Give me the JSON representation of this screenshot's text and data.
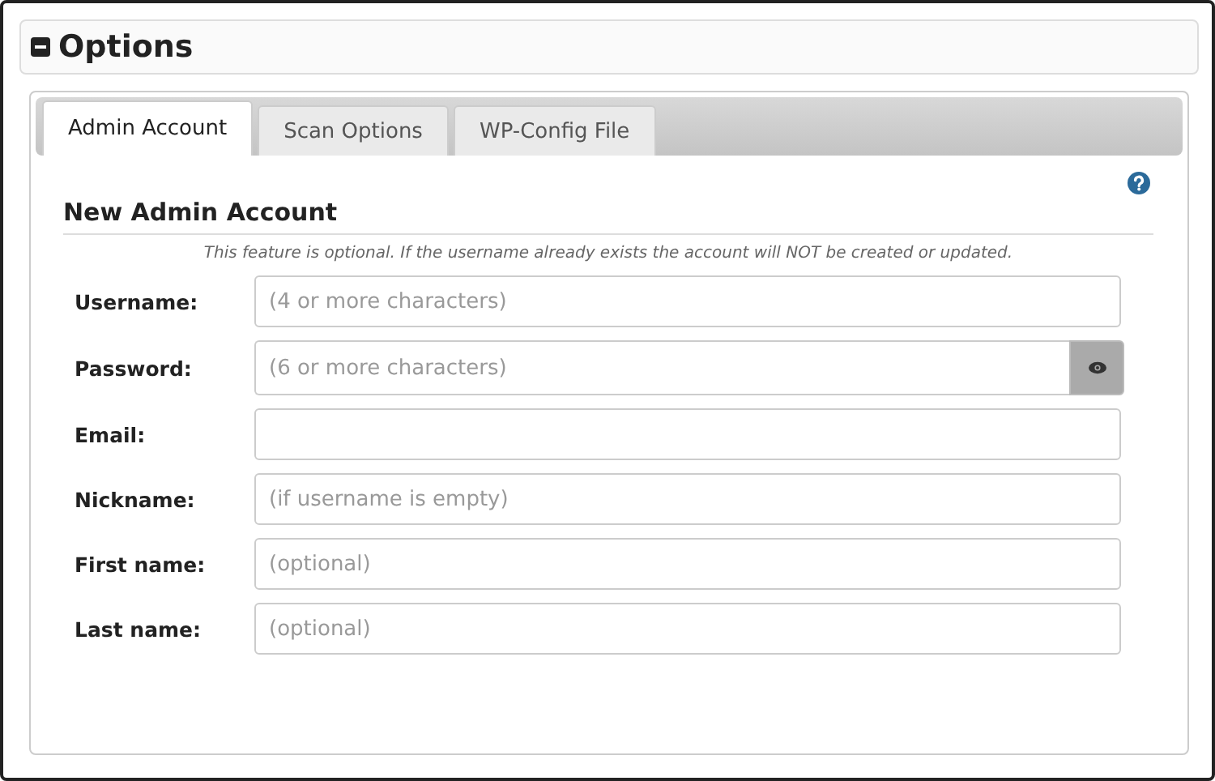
{
  "panel": {
    "title": "Options",
    "expanded": true
  },
  "tabs": [
    {
      "label": "Admin Account",
      "selected": true
    },
    {
      "label": "Scan Options",
      "selected": false
    },
    {
      "label": "WP-Config File",
      "selected": false
    }
  ],
  "section": {
    "title": "New Admin Account",
    "note": "This feature is optional. If the username already exists the account will NOT be created or updated."
  },
  "fields": [
    {
      "label": "Username:",
      "placeholder": "(4 or more characters)",
      "kind": "text"
    },
    {
      "label": "Password:",
      "placeholder": "(6 or more characters)",
      "kind": "password"
    },
    {
      "label": "Email:",
      "kind": "text"
    },
    {
      "label": "Nickname:",
      "placeholder": "(if username is empty)",
      "kind": "text"
    },
    {
      "label": "First name:",
      "placeholder": "(optional)",
      "kind": "text"
    },
    {
      "label": "Last name:",
      "placeholder": "(optional)",
      "kind": "text"
    }
  ]
}
